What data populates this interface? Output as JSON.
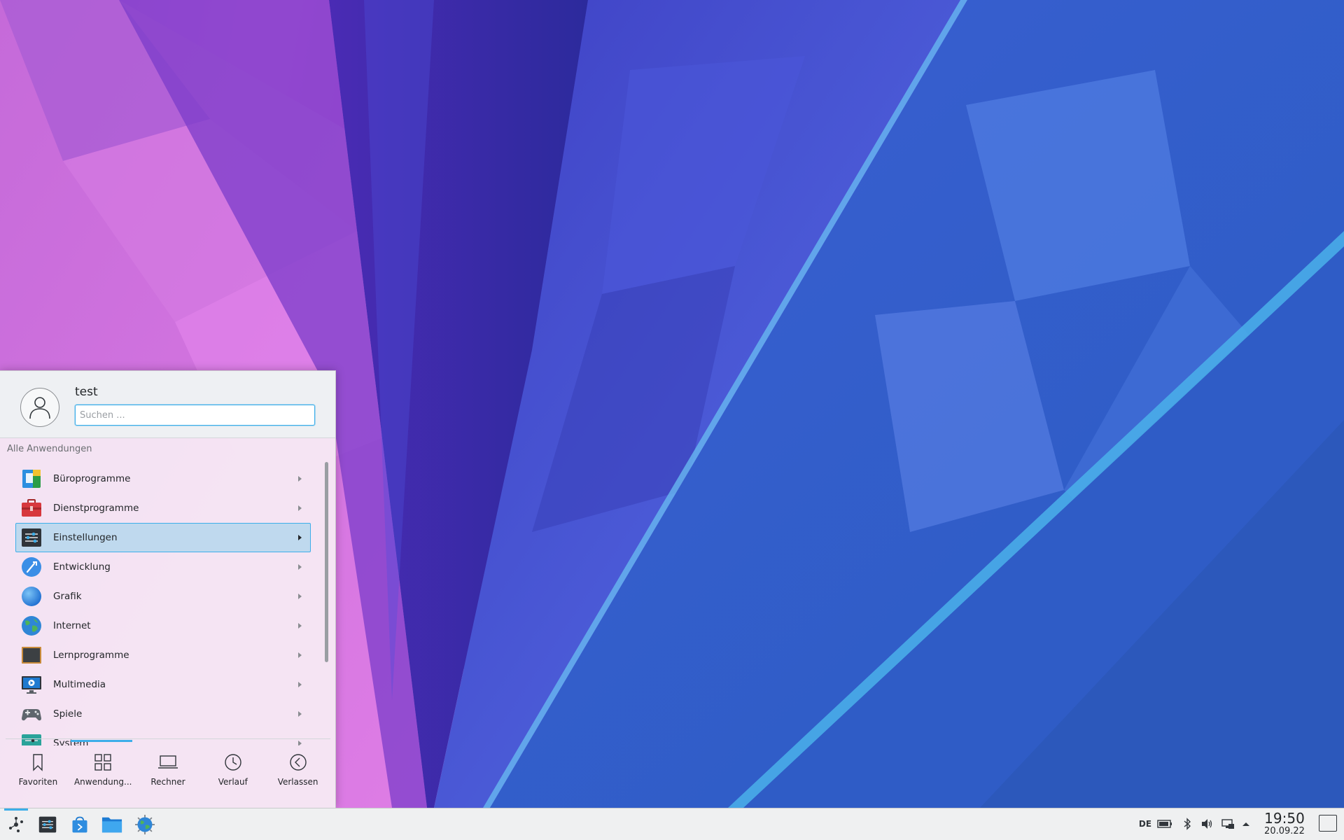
{
  "desktop": {
    "wallpaper": "kde-plasma-polygon-wallpaper"
  },
  "launcher": {
    "username": "test",
    "search": {
      "placeholder": "Suchen ...",
      "value": ""
    },
    "section_title": "Alle Anwendungen",
    "apps": [
      {
        "label": "Büroprogramme",
        "icon": "office-icon",
        "selected": false
      },
      {
        "label": "Dienstprogramme",
        "icon": "utilities-icon",
        "selected": false
      },
      {
        "label": "Einstellungen",
        "icon": "settings-icon",
        "selected": true
      },
      {
        "label": "Entwicklung",
        "icon": "development-icon",
        "selected": false
      },
      {
        "label": "Grafik",
        "icon": "graphics-icon",
        "selected": false
      },
      {
        "label": "Internet",
        "icon": "internet-icon",
        "selected": false
      },
      {
        "label": "Lernprogramme",
        "icon": "education-icon",
        "selected": false
      },
      {
        "label": "Multimedia",
        "icon": "multimedia-icon",
        "selected": false
      },
      {
        "label": "Spiele",
        "icon": "games-icon",
        "selected": false
      },
      {
        "label": "System",
        "icon": "system-icon",
        "selected": false
      }
    ],
    "footer_tabs": [
      {
        "label": "Favoriten",
        "icon": "bookmark-icon"
      },
      {
        "label": "Anwendung...",
        "icon": "grid-icon"
      },
      {
        "label": "Rechner",
        "icon": "laptop-icon"
      },
      {
        "label": "Verlauf",
        "icon": "clock-icon"
      },
      {
        "label": "Verlassen",
        "icon": "back-circle-icon"
      }
    ],
    "active_tab": "Anwendung..."
  },
  "taskbar": {
    "apps": [
      {
        "name": "application-launcher",
        "icon": "kde-launcher-icon"
      },
      {
        "name": "system-settings",
        "icon": "settings-icon"
      },
      {
        "name": "discover",
        "icon": "store-bag-icon"
      },
      {
        "name": "dolphin",
        "icon": "folder-icon"
      },
      {
        "name": "konqueror",
        "icon": "globe-icon"
      }
    ],
    "tray": {
      "keyboard_layout": "DE",
      "icons": [
        "battery-icon",
        "bluetooth-icon",
        "volume-icon",
        "network-icon",
        "expand-arrow-icon"
      ]
    },
    "clock": {
      "time": "19:50",
      "date": "20.09.22"
    }
  },
  "colors": {
    "accent": "#3daee9",
    "selection": "#bfd9ee",
    "text": "#232629",
    "panel": "#eff0f1"
  }
}
